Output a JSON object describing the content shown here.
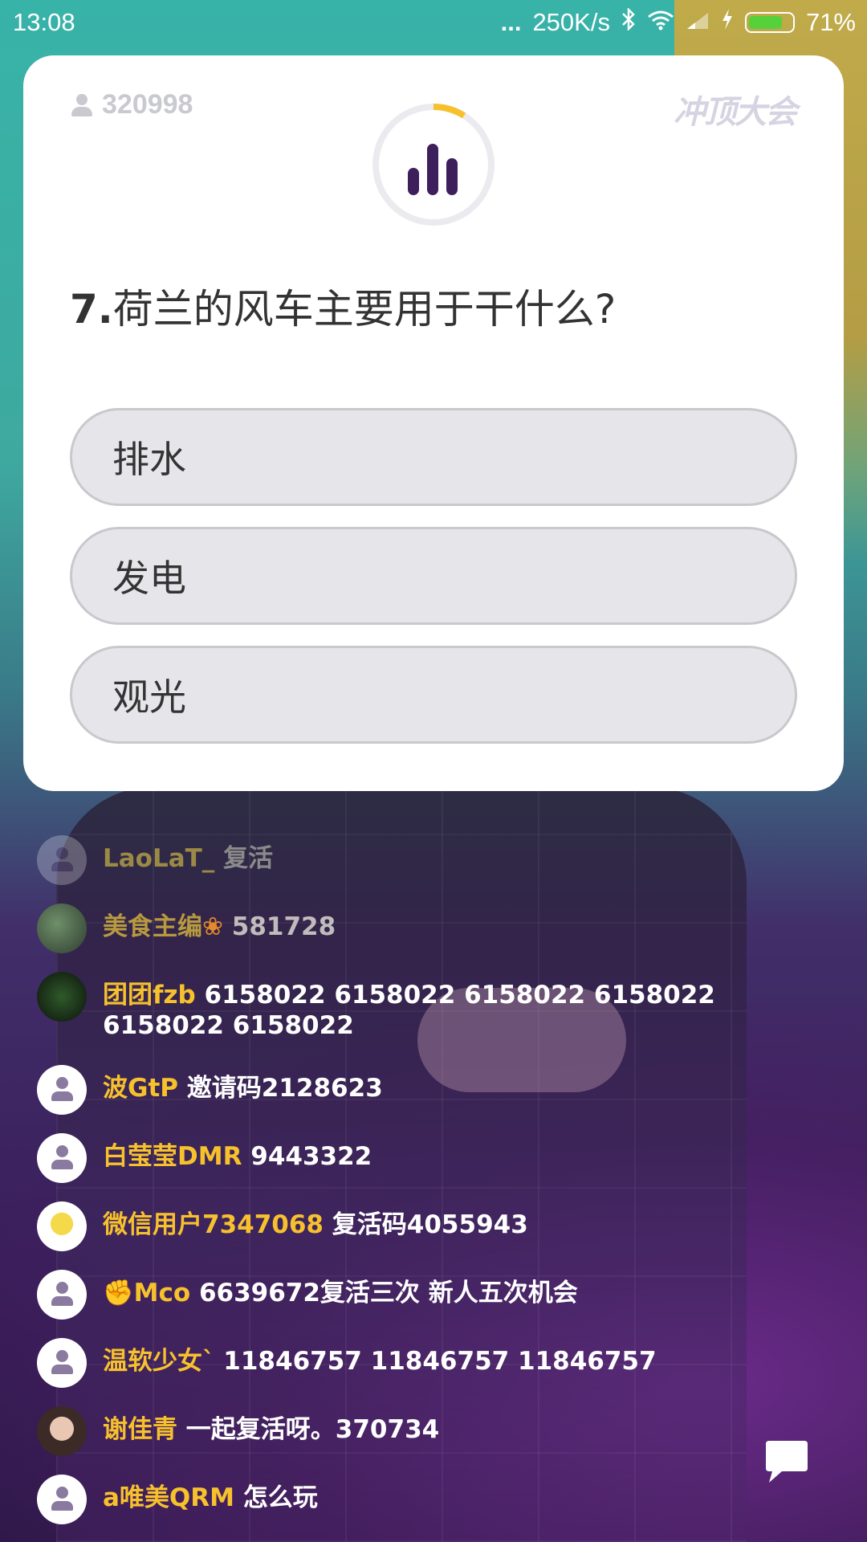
{
  "status_bar": {
    "time": "13:08",
    "dots": "...",
    "net_speed": "250K/s",
    "battery_pct": "71%",
    "icons": [
      "bluetooth-icon",
      "wifi-icon",
      "signal-icon",
      "charging-icon",
      "battery-icon"
    ]
  },
  "card": {
    "player_count": "320998",
    "brand": "冲顶大会",
    "question_number": "7.",
    "question_text": "荷兰的风车主要用于干什么?",
    "options": [
      "排水",
      "发电",
      "观光"
    ],
    "timer_color": "#f7c12d",
    "accent": "#3d1f5c"
  },
  "chat": [
    {
      "user": "LaoLaT_",
      "text": "复活"
    },
    {
      "user": "美食主编",
      "text": "581728"
    },
    {
      "user": "团团fzb",
      "text": "6158022 6158022 6158022 6158022 6158022 6158022"
    },
    {
      "user": "波GtP",
      "text": "邀请码2128623"
    },
    {
      "user": "白莹莹DMR",
      "text": "9443322"
    },
    {
      "user": "微信用户7347068",
      "text": "复活码4055943"
    },
    {
      "user": "Mco",
      "text": "6639672复活三次 新人五次机会"
    },
    {
      "user": "温软少女`",
      "text": "11846757 11846757 11846757"
    },
    {
      "user": "谢佳青",
      "text": "一起复活呀。370734"
    },
    {
      "user": "a唯美QRM",
      "text": "怎么玩"
    }
  ]
}
